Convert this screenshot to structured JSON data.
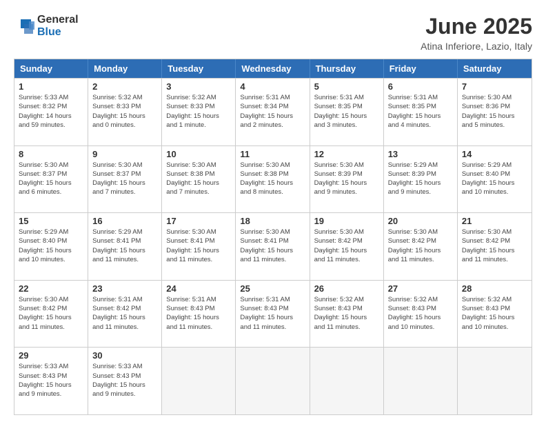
{
  "logo": {
    "general": "General",
    "blue": "Blue"
  },
  "title": "June 2025",
  "subtitle": "Atina Inferiore, Lazio, Italy",
  "headers": [
    "Sunday",
    "Monday",
    "Tuesday",
    "Wednesday",
    "Thursday",
    "Friday",
    "Saturday"
  ],
  "weeks": [
    [
      {
        "day": "1",
        "info": "Sunrise: 5:33 AM\nSunset: 8:32 PM\nDaylight: 14 hours\nand 59 minutes."
      },
      {
        "day": "2",
        "info": "Sunrise: 5:32 AM\nSunset: 8:33 PM\nDaylight: 15 hours\nand 0 minutes."
      },
      {
        "day": "3",
        "info": "Sunrise: 5:32 AM\nSunset: 8:33 PM\nDaylight: 15 hours\nand 1 minute."
      },
      {
        "day": "4",
        "info": "Sunrise: 5:31 AM\nSunset: 8:34 PM\nDaylight: 15 hours\nand 2 minutes."
      },
      {
        "day": "5",
        "info": "Sunrise: 5:31 AM\nSunset: 8:35 PM\nDaylight: 15 hours\nand 3 minutes."
      },
      {
        "day": "6",
        "info": "Sunrise: 5:31 AM\nSunset: 8:35 PM\nDaylight: 15 hours\nand 4 minutes."
      },
      {
        "day": "7",
        "info": "Sunrise: 5:30 AM\nSunset: 8:36 PM\nDaylight: 15 hours\nand 5 minutes."
      }
    ],
    [
      {
        "day": "8",
        "info": "Sunrise: 5:30 AM\nSunset: 8:37 PM\nDaylight: 15 hours\nand 6 minutes."
      },
      {
        "day": "9",
        "info": "Sunrise: 5:30 AM\nSunset: 8:37 PM\nDaylight: 15 hours\nand 7 minutes."
      },
      {
        "day": "10",
        "info": "Sunrise: 5:30 AM\nSunset: 8:38 PM\nDaylight: 15 hours\nand 7 minutes."
      },
      {
        "day": "11",
        "info": "Sunrise: 5:30 AM\nSunset: 8:38 PM\nDaylight: 15 hours\nand 8 minutes."
      },
      {
        "day": "12",
        "info": "Sunrise: 5:30 AM\nSunset: 8:39 PM\nDaylight: 15 hours\nand 9 minutes."
      },
      {
        "day": "13",
        "info": "Sunrise: 5:29 AM\nSunset: 8:39 PM\nDaylight: 15 hours\nand 9 minutes."
      },
      {
        "day": "14",
        "info": "Sunrise: 5:29 AM\nSunset: 8:40 PM\nDaylight: 15 hours\nand 10 minutes."
      }
    ],
    [
      {
        "day": "15",
        "info": "Sunrise: 5:29 AM\nSunset: 8:40 PM\nDaylight: 15 hours\nand 10 minutes."
      },
      {
        "day": "16",
        "info": "Sunrise: 5:29 AM\nSunset: 8:41 PM\nDaylight: 15 hours\nand 11 minutes."
      },
      {
        "day": "17",
        "info": "Sunrise: 5:30 AM\nSunset: 8:41 PM\nDaylight: 15 hours\nand 11 minutes."
      },
      {
        "day": "18",
        "info": "Sunrise: 5:30 AM\nSunset: 8:41 PM\nDaylight: 15 hours\nand 11 minutes."
      },
      {
        "day": "19",
        "info": "Sunrise: 5:30 AM\nSunset: 8:42 PM\nDaylight: 15 hours\nand 11 minutes."
      },
      {
        "day": "20",
        "info": "Sunrise: 5:30 AM\nSunset: 8:42 PM\nDaylight: 15 hours\nand 11 minutes."
      },
      {
        "day": "21",
        "info": "Sunrise: 5:30 AM\nSunset: 8:42 PM\nDaylight: 15 hours\nand 11 minutes."
      }
    ],
    [
      {
        "day": "22",
        "info": "Sunrise: 5:30 AM\nSunset: 8:42 PM\nDaylight: 15 hours\nand 11 minutes."
      },
      {
        "day": "23",
        "info": "Sunrise: 5:31 AM\nSunset: 8:42 PM\nDaylight: 15 hours\nand 11 minutes."
      },
      {
        "day": "24",
        "info": "Sunrise: 5:31 AM\nSunset: 8:43 PM\nDaylight: 15 hours\nand 11 minutes."
      },
      {
        "day": "25",
        "info": "Sunrise: 5:31 AM\nSunset: 8:43 PM\nDaylight: 15 hours\nand 11 minutes."
      },
      {
        "day": "26",
        "info": "Sunrise: 5:32 AM\nSunset: 8:43 PM\nDaylight: 15 hours\nand 11 minutes."
      },
      {
        "day": "27",
        "info": "Sunrise: 5:32 AM\nSunset: 8:43 PM\nDaylight: 15 hours\nand 10 minutes."
      },
      {
        "day": "28",
        "info": "Sunrise: 5:32 AM\nSunset: 8:43 PM\nDaylight: 15 hours\nand 10 minutes."
      }
    ],
    [
      {
        "day": "29",
        "info": "Sunrise: 5:33 AM\nSunset: 8:43 PM\nDaylight: 15 hours\nand 9 minutes."
      },
      {
        "day": "30",
        "info": "Sunrise: 5:33 AM\nSunset: 8:43 PM\nDaylight: 15 hours\nand 9 minutes."
      },
      {
        "day": "",
        "info": ""
      },
      {
        "day": "",
        "info": ""
      },
      {
        "day": "",
        "info": ""
      },
      {
        "day": "",
        "info": ""
      },
      {
        "day": "",
        "info": ""
      }
    ]
  ]
}
